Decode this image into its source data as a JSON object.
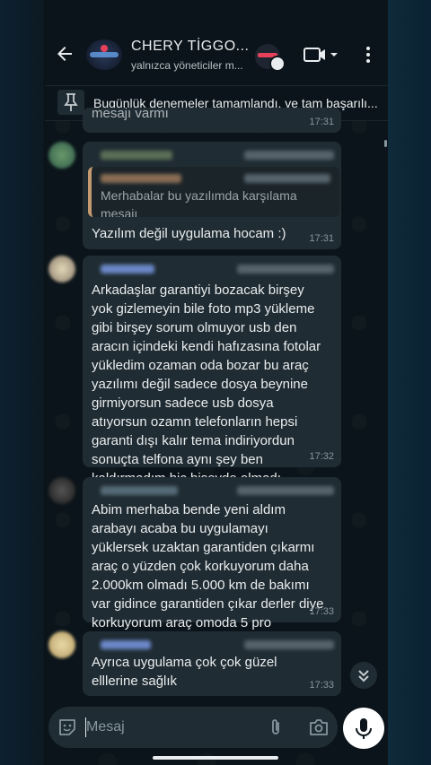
{
  "header": {
    "back_icon": "arrow-left-icon",
    "group_name": "CHERY TİGGO...",
    "subtitle": "yalnızca yöneticiler m...",
    "video_icon": "video-camera-icon",
    "menu_icon": "more-vertical-icon"
  },
  "pinned": {
    "icon": "pin-icon",
    "text": "Bugünlük denemeler tamamlandı, ve tam başarılı..."
  },
  "messages": [
    {
      "partial_text": "mesajı varmı",
      "time": "17:31"
    },
    {
      "quoted_text": "Merhabalar bu yazılımda karşılama mesajı\nvarmı",
      "text": "Yazılım değil uygulama hocam :)",
      "time": "17:31"
    },
    {
      "text": "Arkadaşlar garantiyi bozacak birşey\nyok gizlemeyin bile foto mp3 yükleme\ngibi birşey sorum olmuyor usb den\naracın içindeki kendi hafızasına fotolar\nyükledim ozaman oda bozar bu araç\nyazılımı değil sadece dosya beynine\ngirmiyorsun sadece usb dosya\natıyorsun ozamn telefonların hepsi\ngaranti dışı kalır tema indiriyordun\nsonuçta telfona aynı şey ben\nkaldırmadım hiç bişeyde olmadı",
      "time": "17:32"
    },
    {
      "text": "Abim merhaba bende yeni aldım\narabayı acaba bu uygulamayı\nyüklersek uzaktan garantiden çıkarmı\naraç o yüzden çok korkuyorum daha\n2.000km olmadı 5.000 km de bakımı\nvar gidince garantiden çıkar derler diye\nkorkuyorum araç omoda 5 pro",
      "time": "17:33"
    },
    {
      "text": "Ayrıca uygulama çok çok güzel\nelllerine sağlık",
      "time": "17:33"
    }
  ],
  "composer": {
    "placeholder": "Mesaj",
    "emoji_icon": "sticker-icon",
    "attach_icon": "paperclip-icon",
    "camera_icon": "camera-icon",
    "mic_icon": "microphone-icon"
  },
  "colors": {
    "bubble": "#202c33",
    "background": "#0b141a",
    "text": "#e9edef",
    "timestamp": "#8696a0",
    "quote_bar": "#c69a70"
  }
}
